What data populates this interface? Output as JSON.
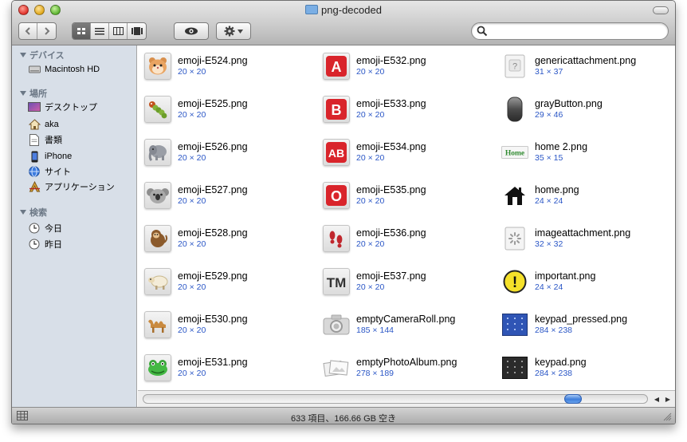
{
  "window": {
    "title": "png-decoded",
    "accent": "#2a56c6",
    "sidebar_bg": "#d8dfe8"
  },
  "toolbar": {
    "back_icon": "chevron-left-icon",
    "forward_icon": "chevron-right-icon",
    "view_modes": [
      {
        "icon": "icon-view-icon",
        "active": true
      },
      {
        "icon": "list-view-icon",
        "active": false
      },
      {
        "icon": "column-view-icon",
        "active": false
      },
      {
        "icon": "coverflow-view-icon",
        "active": false
      }
    ],
    "quicklook_icon": "eye-icon",
    "action_icon": "gear-icon",
    "search": {
      "value": "",
      "placeholder": ""
    }
  },
  "sidebar": {
    "sections": [
      {
        "label": "デバイス",
        "items": [
          {
            "label": "Macintosh HD",
            "icon": "hard-drive-icon"
          }
        ]
      },
      {
        "label": "場所",
        "items": [
          {
            "label": "デスクトップ",
            "icon": "desktop-icon"
          },
          {
            "label": "aka",
            "icon": "home-icon"
          },
          {
            "label": "書類",
            "icon": "documents-icon"
          },
          {
            "label": "iPhone",
            "icon": "iphone-icon"
          },
          {
            "label": "サイト",
            "icon": "globe-icon"
          },
          {
            "label": "アプリケーション",
            "icon": "applications-icon"
          }
        ]
      },
      {
        "label": "検索",
        "items": [
          {
            "label": "今日",
            "icon": "clock-icon"
          },
          {
            "label": "昨日",
            "icon": "clock-icon"
          }
        ]
      }
    ]
  },
  "files": [
    {
      "name": "emoji-E524.png",
      "dims": "20 × 20",
      "icon": "hamster-emoji-icon"
    },
    {
      "name": "emoji-E525.png",
      "dims": "20 × 20",
      "icon": "caterpillar-emoji-icon"
    },
    {
      "name": "emoji-E526.png",
      "dims": "20 × 20",
      "icon": "elephant-emoji-icon"
    },
    {
      "name": "emoji-E527.png",
      "dims": "20 × 20",
      "icon": "koala-emoji-icon"
    },
    {
      "name": "emoji-E528.png",
      "dims": "20 × 20",
      "icon": "monkey-emoji-icon"
    },
    {
      "name": "emoji-E529.png",
      "dims": "20 × 20",
      "icon": "sheep-emoji-icon"
    },
    {
      "name": "emoji-E530.png",
      "dims": "20 × 20",
      "icon": "camel-emoji-icon"
    },
    {
      "name": "emoji-E531.png",
      "dims": "20 × 20",
      "icon": "frog-emoji-icon"
    },
    {
      "name": "emoji-E532.png",
      "dims": "20 × 20",
      "icon": "letter-a-emoji-icon",
      "glyph": "A"
    },
    {
      "name": "emoji-E533.png",
      "dims": "20 × 20",
      "icon": "letter-b-emoji-icon",
      "glyph": "B"
    },
    {
      "name": "emoji-E534.png",
      "dims": "20 × 20",
      "icon": "letters-ab-emoji-icon",
      "glyph": "AB"
    },
    {
      "name": "emoji-E535.png",
      "dims": "20 × 20",
      "icon": "letter-o-emoji-icon",
      "glyph": "O"
    },
    {
      "name": "emoji-E536.png",
      "dims": "20 × 20",
      "icon": "footprints-emoji-icon"
    },
    {
      "name": "emoji-E537.png",
      "dims": "20 × 20",
      "icon": "trademark-emoji-icon",
      "glyph": "TM"
    },
    {
      "name": "emptyCameraRoll.png",
      "dims": "185 × 144",
      "icon": "camera-icon"
    },
    {
      "name": "emptyPhotoAlbum.png",
      "dims": "278 × 189",
      "icon": "photo-album-icon"
    },
    {
      "name": "genericattachment.png",
      "dims": "31 × 37",
      "icon": "generic-attachment-icon",
      "glyph": "?"
    },
    {
      "name": "grayButton.png",
      "dims": "29 × 46",
      "icon": "gray-button-icon"
    },
    {
      "name": "home 2.png",
      "dims": "35 × 15",
      "icon": "home-label-icon",
      "glyph": "Home"
    },
    {
      "name": "home.png",
      "dims": "24 × 24",
      "icon": "house-icon"
    },
    {
      "name": "imageattachment.png",
      "dims": "32 × 32",
      "icon": "image-attachment-icon"
    },
    {
      "name": "important.png",
      "dims": "24 × 24",
      "icon": "exclamation-icon",
      "glyph": "!"
    },
    {
      "name": "keypad_pressed.png",
      "dims": "284 × 238",
      "icon": "keypad-pressed-icon"
    },
    {
      "name": "keypad.png",
      "dims": "284 × 238",
      "icon": "keypad-icon"
    }
  ],
  "scrollbar": {
    "position_fraction": 0.87
  },
  "status": {
    "text": "633 項目、166.66 GB 空き"
  }
}
